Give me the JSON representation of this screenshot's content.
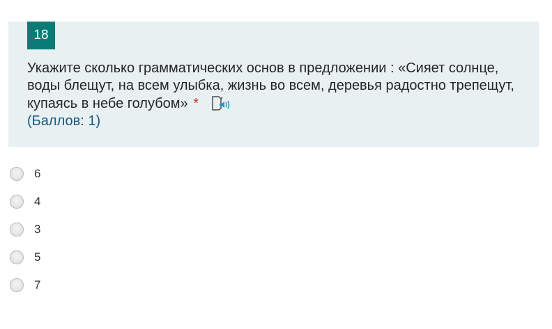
{
  "question": {
    "number": "18",
    "text": "Укажите сколько грамматических основ в предложении : «Сияет солнце, воды блещут, на всем улыбка, жизнь во всем, деревья радостно трепещут, купаясь в небе голубом»",
    "required_mark": "*",
    "points": "(Баллов: 1)",
    "speaker_icon": "speaker-icon"
  },
  "options": [
    {
      "label": "6"
    },
    {
      "label": "4"
    },
    {
      "label": "3"
    },
    {
      "label": "5"
    },
    {
      "label": "7"
    }
  ],
  "colors": {
    "accent": "#0a7c75",
    "card_background": "#e9f0f2",
    "required": "#c0392b"
  }
}
